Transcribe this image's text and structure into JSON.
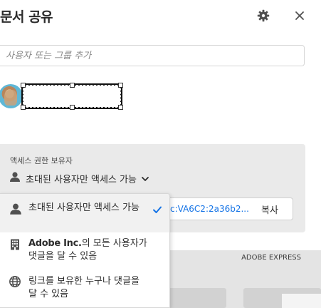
{
  "dialog": {
    "title": "문서 공유",
    "search_placeholder": "사용자 또는 그룹 추가"
  },
  "icons": {
    "settings": "gear-icon",
    "close": "close-icon",
    "user": "user-icon",
    "building": "building-icon",
    "globe": "globe-icon",
    "check": "checkmark-icon",
    "chevron": "chevron-down-icon"
  },
  "access": {
    "label": "액세스 권한 보유자",
    "selected": "초대된 사용자만 액세스 가능"
  },
  "link": {
    "value": "c:VA6C2:2a36b2...",
    "copy_label": "복사"
  },
  "background": {
    "card_label": "ADOBE EXPRESS"
  },
  "dropdown": {
    "options": [
      {
        "text": "초대된 사용자만 액세스 가능",
        "selected": true
      },
      {
        "bold": "Adobe Inc.",
        "text": "의 모든 사용자가 댓글을 달 수 있음",
        "selected": false
      },
      {
        "text": "링크를 보유한 누구나 댓글을 달 수 있음",
        "selected": false
      }
    ]
  },
  "colors": {
    "accent": "#1473e6",
    "panel": "#eaeaea"
  }
}
